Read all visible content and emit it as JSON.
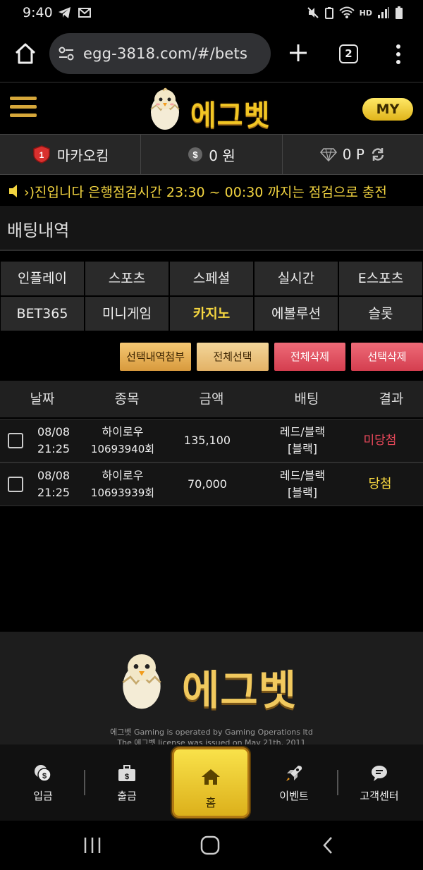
{
  "status_bar": {
    "time": "9:40",
    "network_label": "HD"
  },
  "browser": {
    "url": "egg-3818.com/#/bets",
    "tab_count": "2"
  },
  "header": {
    "logo_text": "에그벳",
    "my_label": "MY"
  },
  "user_info": {
    "username": "마카오킴",
    "level_badge": "1",
    "money": "0 원",
    "points": "0 P"
  },
  "notice": {
    "text": "›)진입니다 은행점검시간 23:30 ~ 00:30 까지는 점검으로 충전"
  },
  "page": {
    "title": "배팅내역"
  },
  "categories": [
    {
      "label": "인플레이",
      "active": false
    },
    {
      "label": "스포츠",
      "active": false
    },
    {
      "label": "스페셜",
      "active": false
    },
    {
      "label": "실시간",
      "active": false
    },
    {
      "label": "E스포츠",
      "active": false
    },
    {
      "label": "BET365",
      "active": false
    },
    {
      "label": "미니게임",
      "active": false
    },
    {
      "label": "카지노",
      "active": true
    },
    {
      "label": "에볼루션",
      "active": false
    },
    {
      "label": "슬롯",
      "active": false
    }
  ],
  "actions": {
    "attach_selected": "선택내역첨부",
    "select_all": "전체선택",
    "delete_all": "전체삭제",
    "delete_selected": "선택삭제"
  },
  "table": {
    "headers": {
      "date": "날짜",
      "game": "종목",
      "amount": "금액",
      "bet": "배팅",
      "result": "결과"
    },
    "rows": [
      {
        "date": "08/08",
        "time": "21:25",
        "game": "하이로우",
        "round": "10693940회",
        "amount": "135,100",
        "bet": "레드/블랙",
        "pick": "[블랙]",
        "result": "미당첨",
        "won": false
      },
      {
        "date": "08/08",
        "time": "21:25",
        "game": "하이로우",
        "round": "10693939회",
        "amount": "70,000",
        "bet": "레드/블랙",
        "pick": "[블랙]",
        "result": "당첨",
        "won": true
      }
    ]
  },
  "footer": {
    "logo_text": "에그벳",
    "line1": "에그벳 Gaming is operated by Gaming Operations ltd",
    "line2": "The 에그벳 license was issued on May 21th, 2011"
  },
  "bottom_nav": {
    "deposit": "입금",
    "withdraw": "출금",
    "home": "홈",
    "event": "이벤트",
    "support": "고객센터"
  },
  "colors": {
    "gold": "#f2c624",
    "win": "#f5d640",
    "lose": "#e8485a"
  }
}
